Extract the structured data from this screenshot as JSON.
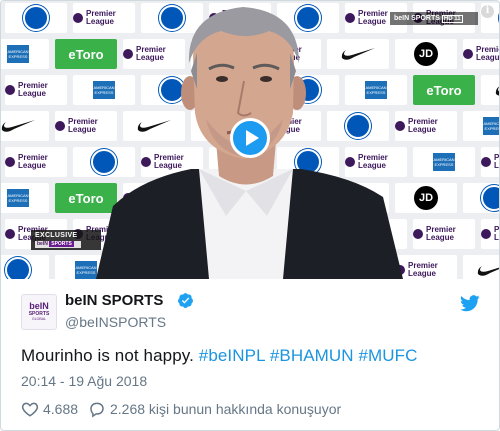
{
  "video": {
    "badge_title": "EXCLUSIVE",
    "badge_logo_left": "beIN",
    "badge_logo_right": "SPORTS",
    "corner_logo": "beIN SPORTS",
    "corner_hd": "HD 11",
    "info_glyph": "i",
    "play_icon": "play-icon",
    "board_texts": {
      "premier_league": "Premier League",
      "etoro": "eToro",
      "jd": "JD",
      "amex": "AMERICAN EXPRESS"
    }
  },
  "author": {
    "avatar_line1": "beIN",
    "avatar_line2": "SPORTS",
    "avatar_line3": "GLOBAL",
    "display_name": "beIN SPORTS",
    "handle": "@beINSPORTS",
    "verified_icon": "verified-badge-icon"
  },
  "tweet": {
    "text_plain": "Mourinho is not happy. ",
    "hashtags": [
      "#beINPL",
      "#BHAMUN",
      "#MUFC"
    ],
    "timestamp": "20:14 - 19 Ağu 2018"
  },
  "actions": {
    "likes_count": "4.688",
    "replies_text": "2.268 kişi bunun hakkında konuşuyor"
  },
  "colors": {
    "accent": "#1b95e0",
    "play_button": "#1d9bf0",
    "heart_icon": "#657786",
    "text": "#14171a",
    "secondary_text": "#657786",
    "etoro_green": "#3bb14a",
    "bein_purple": "#5c2178"
  }
}
